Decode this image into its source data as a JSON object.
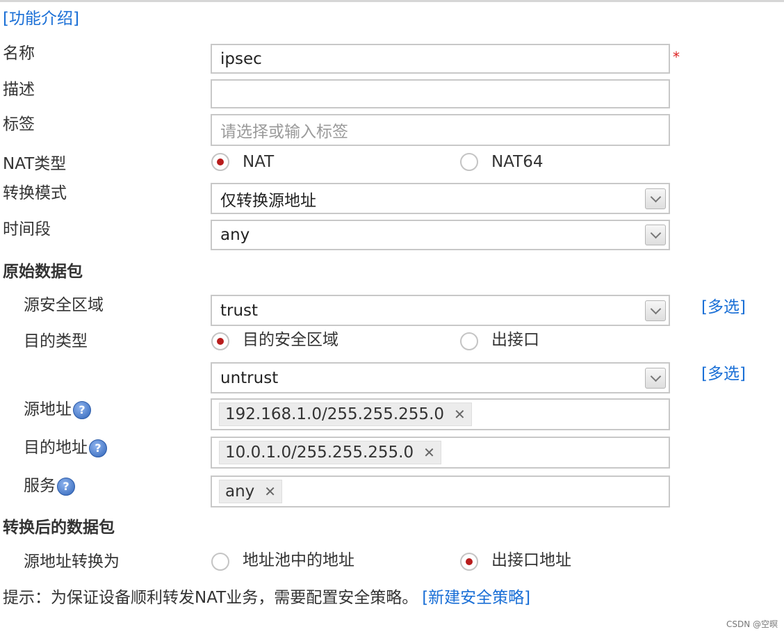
{
  "intro_link": "[功能介绍]",
  "fields": {
    "name": {
      "label": "名称",
      "value": "ipsec",
      "required_mark": "*"
    },
    "description": {
      "label": "描述",
      "value": ""
    },
    "tag": {
      "label": "标签",
      "placeholder": "请选择或输入标签"
    },
    "nat_type": {
      "label": "NAT类型",
      "options": [
        "NAT",
        "NAT64"
      ],
      "selected": "NAT"
    },
    "convert_mode": {
      "label": "转换模式",
      "value": "仅转换源地址"
    },
    "time_range": {
      "label": "时间段",
      "value": "any"
    }
  },
  "original_packet": {
    "title": "原始数据包",
    "src_zone": {
      "label": "源安全区域",
      "value": "trust",
      "multi_link": "[多选]"
    },
    "dst_type": {
      "label": "目的类型",
      "options": [
        "目的安全区域",
        "出接口"
      ],
      "selected": "目的安全区域"
    },
    "dst_zone": {
      "value": "untrust",
      "multi_link": "[多选]"
    },
    "src_addr": {
      "label": "源地址",
      "tags": [
        "192.168.1.0/255.255.255.0"
      ]
    },
    "dst_addr": {
      "label": "目的地址",
      "tags": [
        "10.0.1.0/255.255.255.0"
      ]
    },
    "service": {
      "label": "服务",
      "tags": [
        "any"
      ]
    }
  },
  "translated_packet": {
    "title": "转换后的数据包",
    "src_translate": {
      "label": "源地址转换为",
      "options": [
        "地址池中的地址",
        "出接口地址"
      ],
      "selected": "出接口地址"
    }
  },
  "hint": {
    "text": "提示：为保证设备顺利转发NAT业务，需要配置安全策略。",
    "link": "[新建安全策略]"
  },
  "icons": {
    "help": "help-question-icon",
    "dropdown": "chevron-down-icon",
    "remove": "close-icon"
  },
  "colors": {
    "link": "#1a6fd6",
    "radio_selected": "#b81c1c",
    "required": "#dd2222"
  },
  "watermark": "CSDN @空暝"
}
